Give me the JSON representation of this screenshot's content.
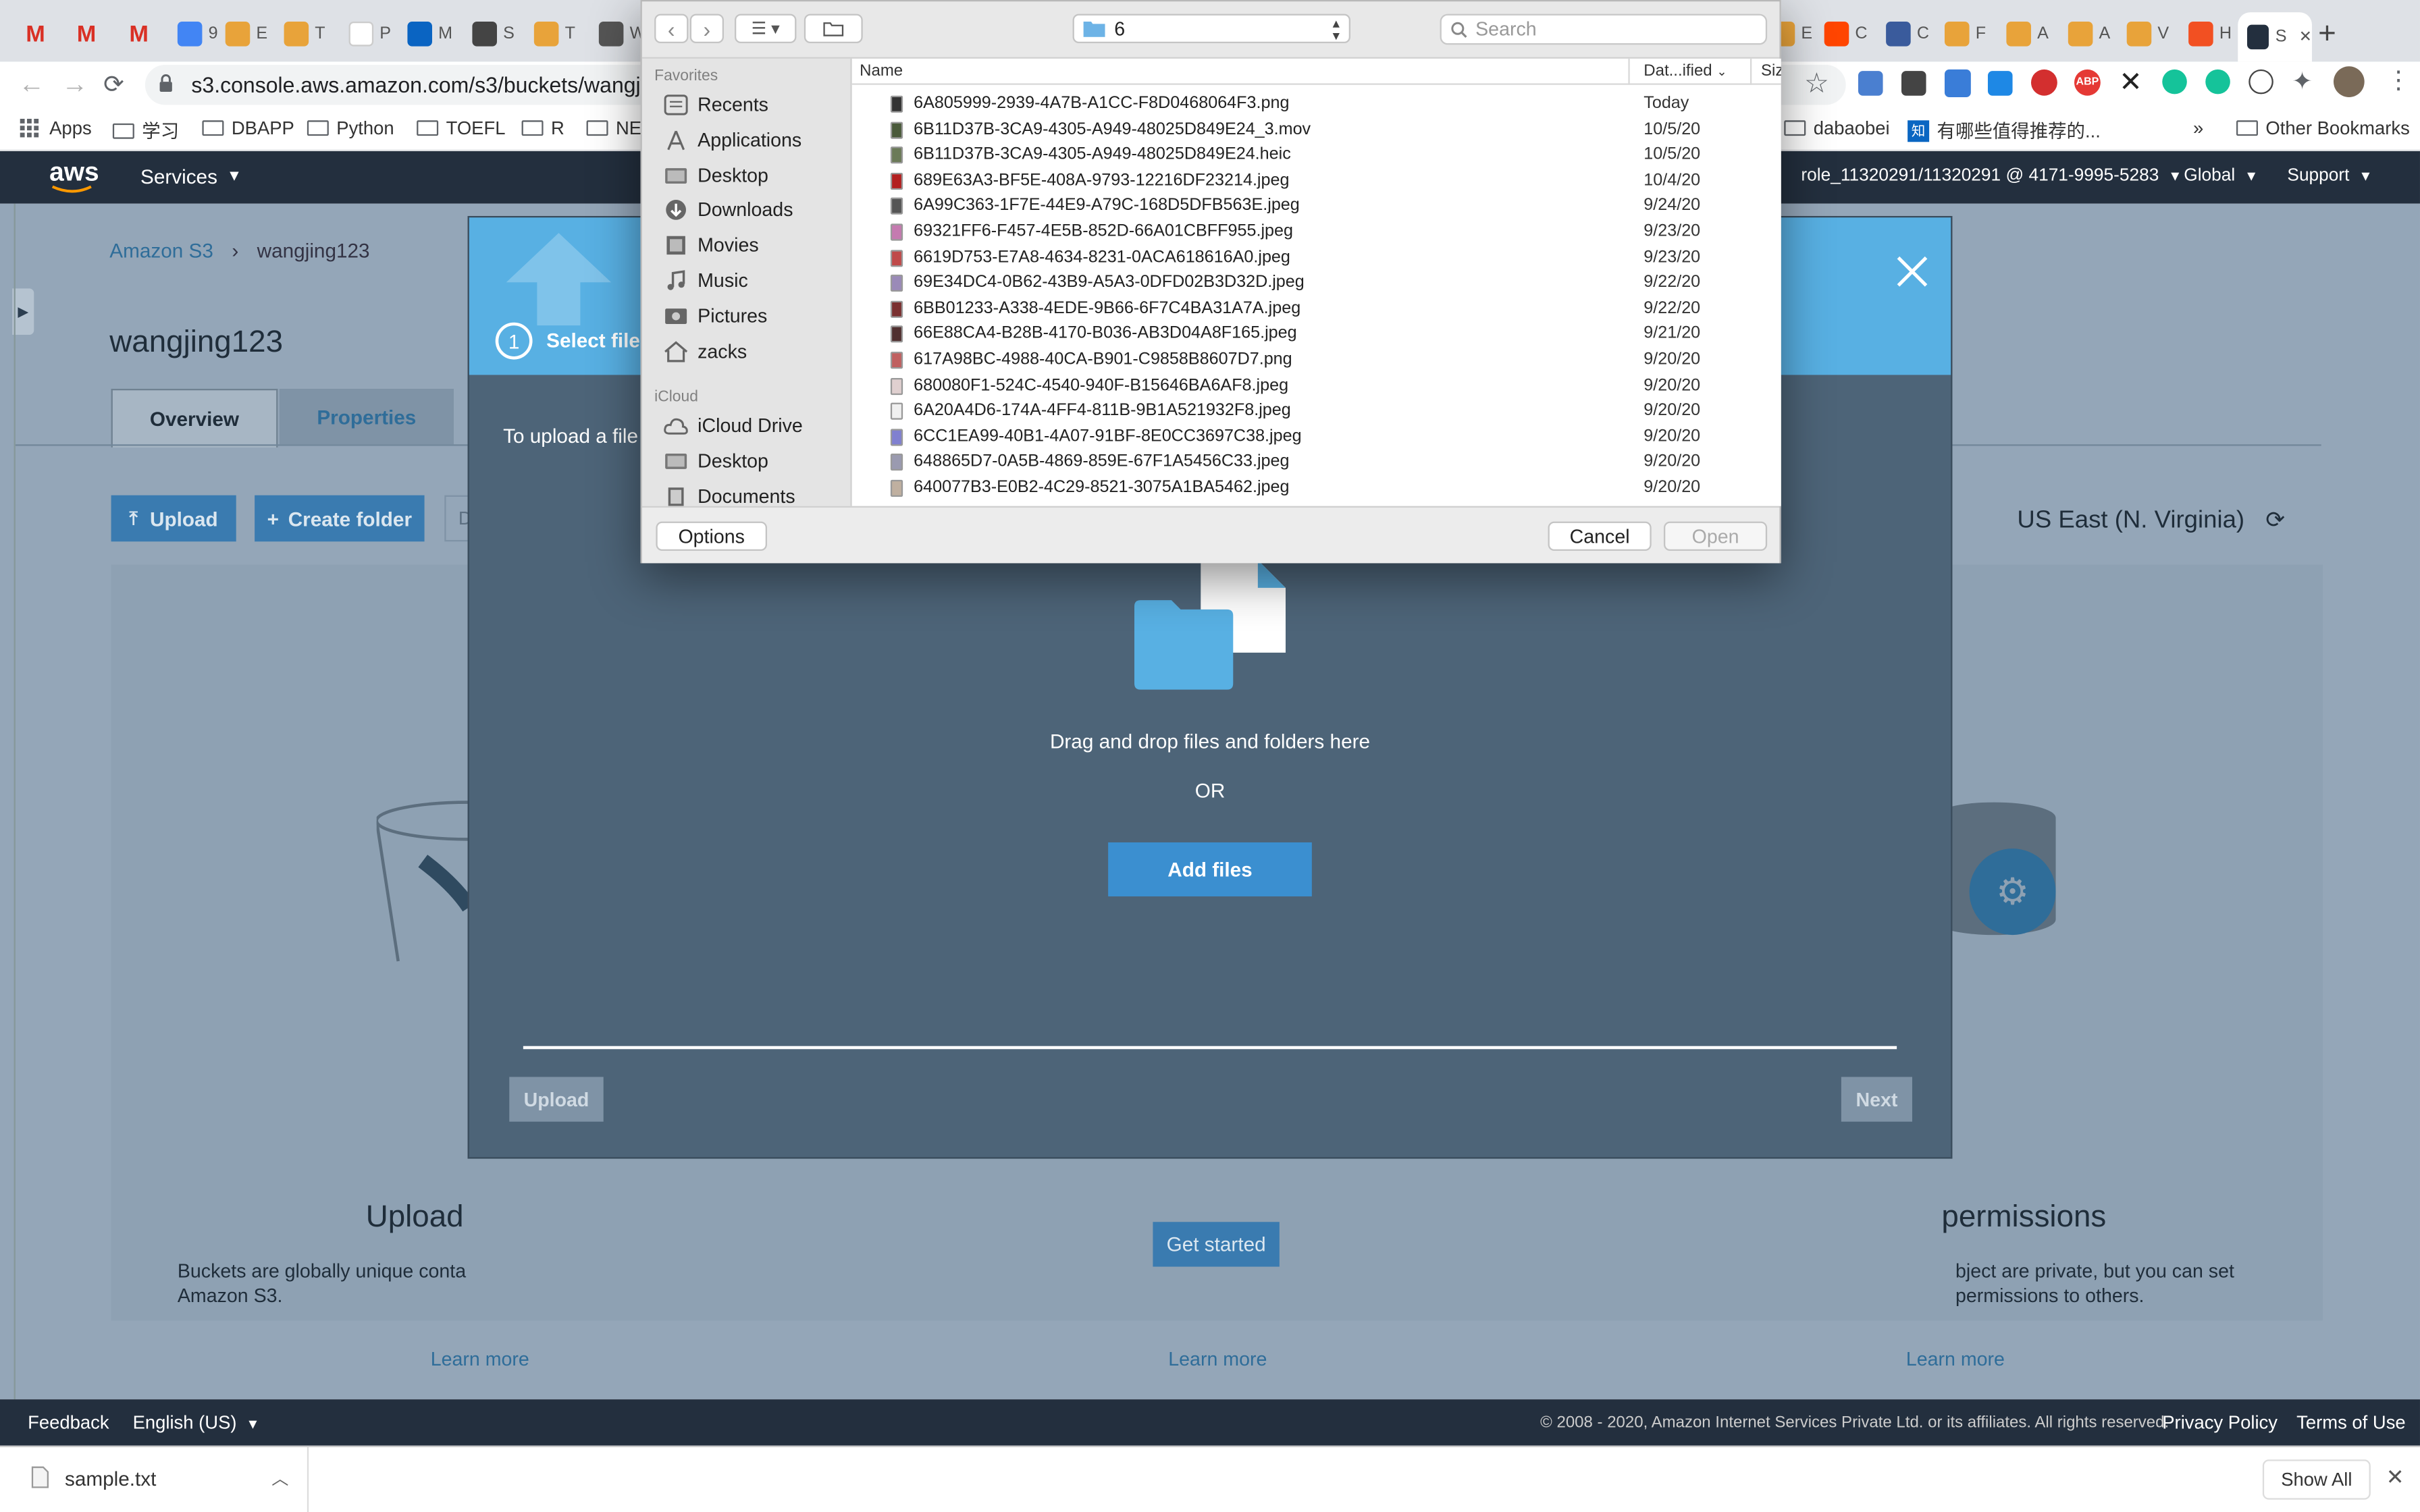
{
  "browser": {
    "tabs": [
      {
        "icon": "gmail-icon",
        "label": ""
      },
      {
        "icon": "gmail-icon",
        "label": ""
      },
      {
        "icon": "gmail-icon",
        "label": ""
      },
      {
        "icon": "calendar-icon",
        "label": "9"
      },
      {
        "icon": "app-icon",
        "label": "E"
      },
      {
        "icon": "app-icon",
        "label": "T"
      },
      {
        "icon": "blank-icon",
        "label": "P"
      },
      {
        "icon": "outlook-icon",
        "label": "M"
      },
      {
        "icon": "sb-icon",
        "label": "S"
      },
      {
        "icon": "app-icon",
        "label": "T"
      },
      {
        "icon": "globe-icon",
        "label": "W"
      },
      {
        "icon": "app-icon",
        "label": "E"
      },
      {
        "icon": "reddit-icon",
        "label": "C"
      },
      {
        "icon": "seal-icon",
        "label": "C"
      },
      {
        "icon": "app-icon",
        "label": "F"
      },
      {
        "icon": "app-icon",
        "label": "A"
      },
      {
        "icon": "app-icon",
        "label": "A"
      },
      {
        "icon": "app-icon",
        "label": "V"
      },
      {
        "icon": "ms-icon",
        "label": "H"
      },
      {
        "icon": "aws-icon",
        "label": "S"
      }
    ],
    "url": "s3.console.aws.amazon.com/s3/buckets/wangjing",
    "bookmarks": [
      "Apps",
      "学习",
      "DBAPP",
      "Python",
      "TOEFL",
      "R",
      "NE",
      "dabaobei",
      "有哪些值得推荐的...",
      "»",
      "Other Bookmarks"
    ]
  },
  "aws": {
    "logo": "aws",
    "services": "Services",
    "role": "role_11320291/11320291 @ 4171-9995-5283",
    "region_menu": "Global",
    "support": "Support"
  },
  "s3": {
    "breadcrumb_root": "Amazon S3",
    "breadcrumb_sep": "›",
    "breadcrumb_bucket": "wangjing123",
    "bucket_title": "wangjing123",
    "tabs": [
      "Overview",
      "Properties"
    ],
    "upload_btn": "Upload",
    "create_folder_btn": "Create folder",
    "search_stub": "D",
    "region": "US East (N. Virginia)",
    "card_left_title": "Upload",
    "card_left_text1": "Buckets are globally unique conta",
    "card_left_text2": "Amazon S3.",
    "card_left_link": "Learn more",
    "card_mid_link": "Learn more",
    "card_right_title": "permissions",
    "card_right_text1": "bject are private, but you can set",
    "card_right_text2": "permissions to others.",
    "card_right_link": "Learn more",
    "get_started": "Get started"
  },
  "upload_modal": {
    "step_number": "1",
    "step_label": "Select files",
    "intro": "To upload a file l",
    "drop_text": "Drag and drop files and folders here",
    "or_text": "OR",
    "add_files": "Add files",
    "upload_btn": "Upload",
    "next_btn": "Next"
  },
  "finder": {
    "folder_name": "6",
    "search_placeholder": "Search",
    "sidebar_favorites_header": "Favorites",
    "sidebar_favorites": [
      {
        "label": "Recents",
        "icon": "recents-icon"
      },
      {
        "label": "Applications",
        "icon": "applications-icon"
      },
      {
        "label": "Desktop",
        "icon": "desktop-icon"
      },
      {
        "label": "Downloads",
        "icon": "downloads-icon"
      },
      {
        "label": "Movies",
        "icon": "movies-icon"
      },
      {
        "label": "Music",
        "icon": "music-icon"
      },
      {
        "label": "Pictures",
        "icon": "pictures-icon"
      },
      {
        "label": "zacks",
        "icon": "home-icon"
      }
    ],
    "sidebar_icloud_header": "iCloud",
    "sidebar_icloud": [
      {
        "label": "iCloud Drive",
        "icon": "cloud-icon"
      },
      {
        "label": "Desktop",
        "icon": "desktop-icon"
      },
      {
        "label": "Documents",
        "icon": "documents-icon"
      }
    ],
    "col_name": "Name",
    "col_date": "Dat...ified",
    "col_size": "Siz",
    "files": [
      {
        "name": "6A805999-2939-4A7B-A1CC-F8D0468064F3.png",
        "date": "Today",
        "color": "#333"
      },
      {
        "name": "6B11D37B-3CA9-4305-A949-48025D849E24_3.mov",
        "date": "10/5/20",
        "color": "#4a5a3a"
      },
      {
        "name": "6B11D37B-3CA9-4305-A949-48025D849E24.heic",
        "date": "10/5/20",
        "color": "#6b7a58"
      },
      {
        "name": "689E63A3-BF5E-408A-9793-12216DF23214.jpeg",
        "date": "10/4/20",
        "color": "#b32020"
      },
      {
        "name": "6A99C363-1F7E-44E9-A79C-168D5DFB563E.jpeg",
        "date": "9/24/20",
        "color": "#555"
      },
      {
        "name": "69321FF6-F457-4E5B-852D-66A01CBFF955.jpeg",
        "date": "9/23/20",
        "color": "#c57ab0"
      },
      {
        "name": "6619D753-E7A8-4634-8231-0ACA618616A0.jpeg",
        "date": "9/23/20",
        "color": "#c04a4a"
      },
      {
        "name": "69E34DC4-0B62-43B9-A5A3-0DFD02B3D32D.jpeg",
        "date": "9/22/20",
        "color": "#9a8ab8"
      },
      {
        "name": "6BB01233-A338-4EDE-9B66-6F7C4BA31A7A.jpeg",
        "date": "9/22/20",
        "color": "#7a3030"
      },
      {
        "name": "66E88CA4-B28B-4170-B036-AB3D04A8F165.jpeg",
        "date": "9/21/20",
        "color": "#503030"
      },
      {
        "name": "617A98BC-4988-40CA-B901-C9858B8607D7.png",
        "date": "9/20/20",
        "color": "#c06060"
      },
      {
        "name": "680080F1-524C-4540-940F-B15646BA6AF8.jpeg",
        "date": "9/20/20",
        "color": "#e0d0d0"
      },
      {
        "name": "6A20A4D6-174A-4FF4-811B-9B1A521932F8.jpeg",
        "date": "9/20/20",
        "color": "#f0f0f0"
      },
      {
        "name": "6CC1EA99-40B1-4A07-91BF-8E0CC3697C38.jpeg",
        "date": "9/20/20",
        "color": "#8080d0"
      },
      {
        "name": "648865D7-0A5B-4869-859E-67F1A5456C33.jpeg",
        "date": "9/20/20",
        "color": "#9a9ab0"
      },
      {
        "name": "640077B3-E0B2-4C29-8521-3075A1BA5462.jpeg",
        "date": "9/20/20",
        "color": "#c0b0a0"
      }
    ],
    "options_btn": "Options",
    "cancel_btn": "Cancel",
    "open_btn": "Open"
  },
  "footer": {
    "feedback": "Feedback",
    "language": "English (US)",
    "copyright": "© 2008 - 2020, Amazon Internet Services Private Ltd. or its affiliates. All rights reserved.",
    "privacy": "Privacy Policy",
    "terms": "Terms of Use"
  },
  "downloads": {
    "file": "sample.txt",
    "show_all": "Show All"
  },
  "colors": {
    "aws_dark": "#232f3e",
    "aws_blue": "#58b0e3",
    "btn_blue": "#3a8fcb",
    "modal_bg": "#4d6478"
  }
}
